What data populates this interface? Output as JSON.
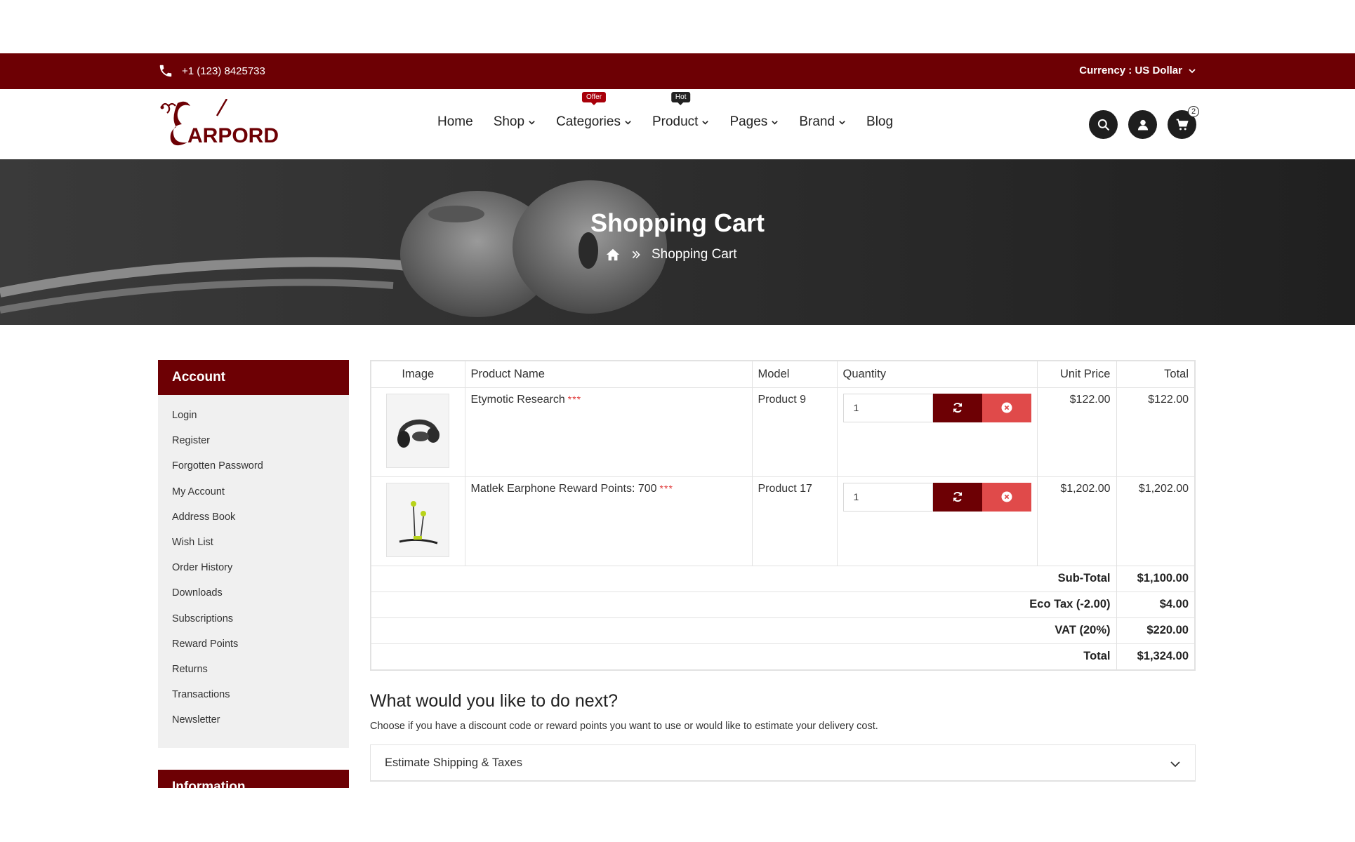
{
  "topbar": {
    "phone": "+1 (123) 8425733",
    "currency": "Currency : US Dollar"
  },
  "header": {
    "nav": [
      {
        "label": "Home",
        "chevron": false
      },
      {
        "label": "Shop",
        "chevron": true
      },
      {
        "label": "Categories",
        "chevron": true,
        "badge": "Offer"
      },
      {
        "label": "Product",
        "chevron": true,
        "badge": "Hot"
      },
      {
        "label": "Pages",
        "chevron": true
      },
      {
        "label": "Brand",
        "chevron": true
      },
      {
        "label": "Blog",
        "chevron": false
      }
    ],
    "cart_count": "2"
  },
  "banner": {
    "title": "Shopping Cart",
    "breadcrumb_current": "Shopping Cart"
  },
  "sidebar": {
    "heading": "Account",
    "items": [
      "Login",
      "Register",
      "Forgotten Password",
      "My Account",
      "Address Book",
      "Wish List",
      "Order History",
      "Downloads",
      "Subscriptions",
      "Reward Points",
      "Returns",
      "Transactions",
      "Newsletter"
    ],
    "heading2": "Information"
  },
  "cart": {
    "columns": {
      "image": "Image",
      "name": "Product Name",
      "model": "Model",
      "quantity": "Quantity",
      "unit_price": "Unit Price",
      "total": "Total"
    },
    "items": [
      {
        "name": "Etymotic Research",
        "stars": "***",
        "model": "Product 9",
        "quantity": "1",
        "unit_price": "$122.00",
        "total": "$122.00"
      },
      {
        "name": "Matlek Earphone Reward Points: 700",
        "stars": "***",
        "model": "Product 17",
        "quantity": "1",
        "unit_price": "$1,202.00",
        "total": "$1,202.00"
      }
    ],
    "summary": [
      {
        "label": "Sub-Total",
        "value": "$1,100.00"
      },
      {
        "label": "Eco Tax (-2.00)",
        "value": "$4.00"
      },
      {
        "label": "VAT (20%)",
        "value": "$220.00"
      },
      {
        "label": "Total",
        "value": "$1,324.00"
      }
    ]
  },
  "next": {
    "title": "What would you like to do next?",
    "description": "Choose if you have a discount code or reward points you want to use or would like to estimate your delivery cost.",
    "shipping_label": "Estimate Shipping & Taxes"
  },
  "colors": {
    "brand": "#6d0004",
    "remove": "#e04a4a",
    "dark": "#1e1e1e"
  }
}
